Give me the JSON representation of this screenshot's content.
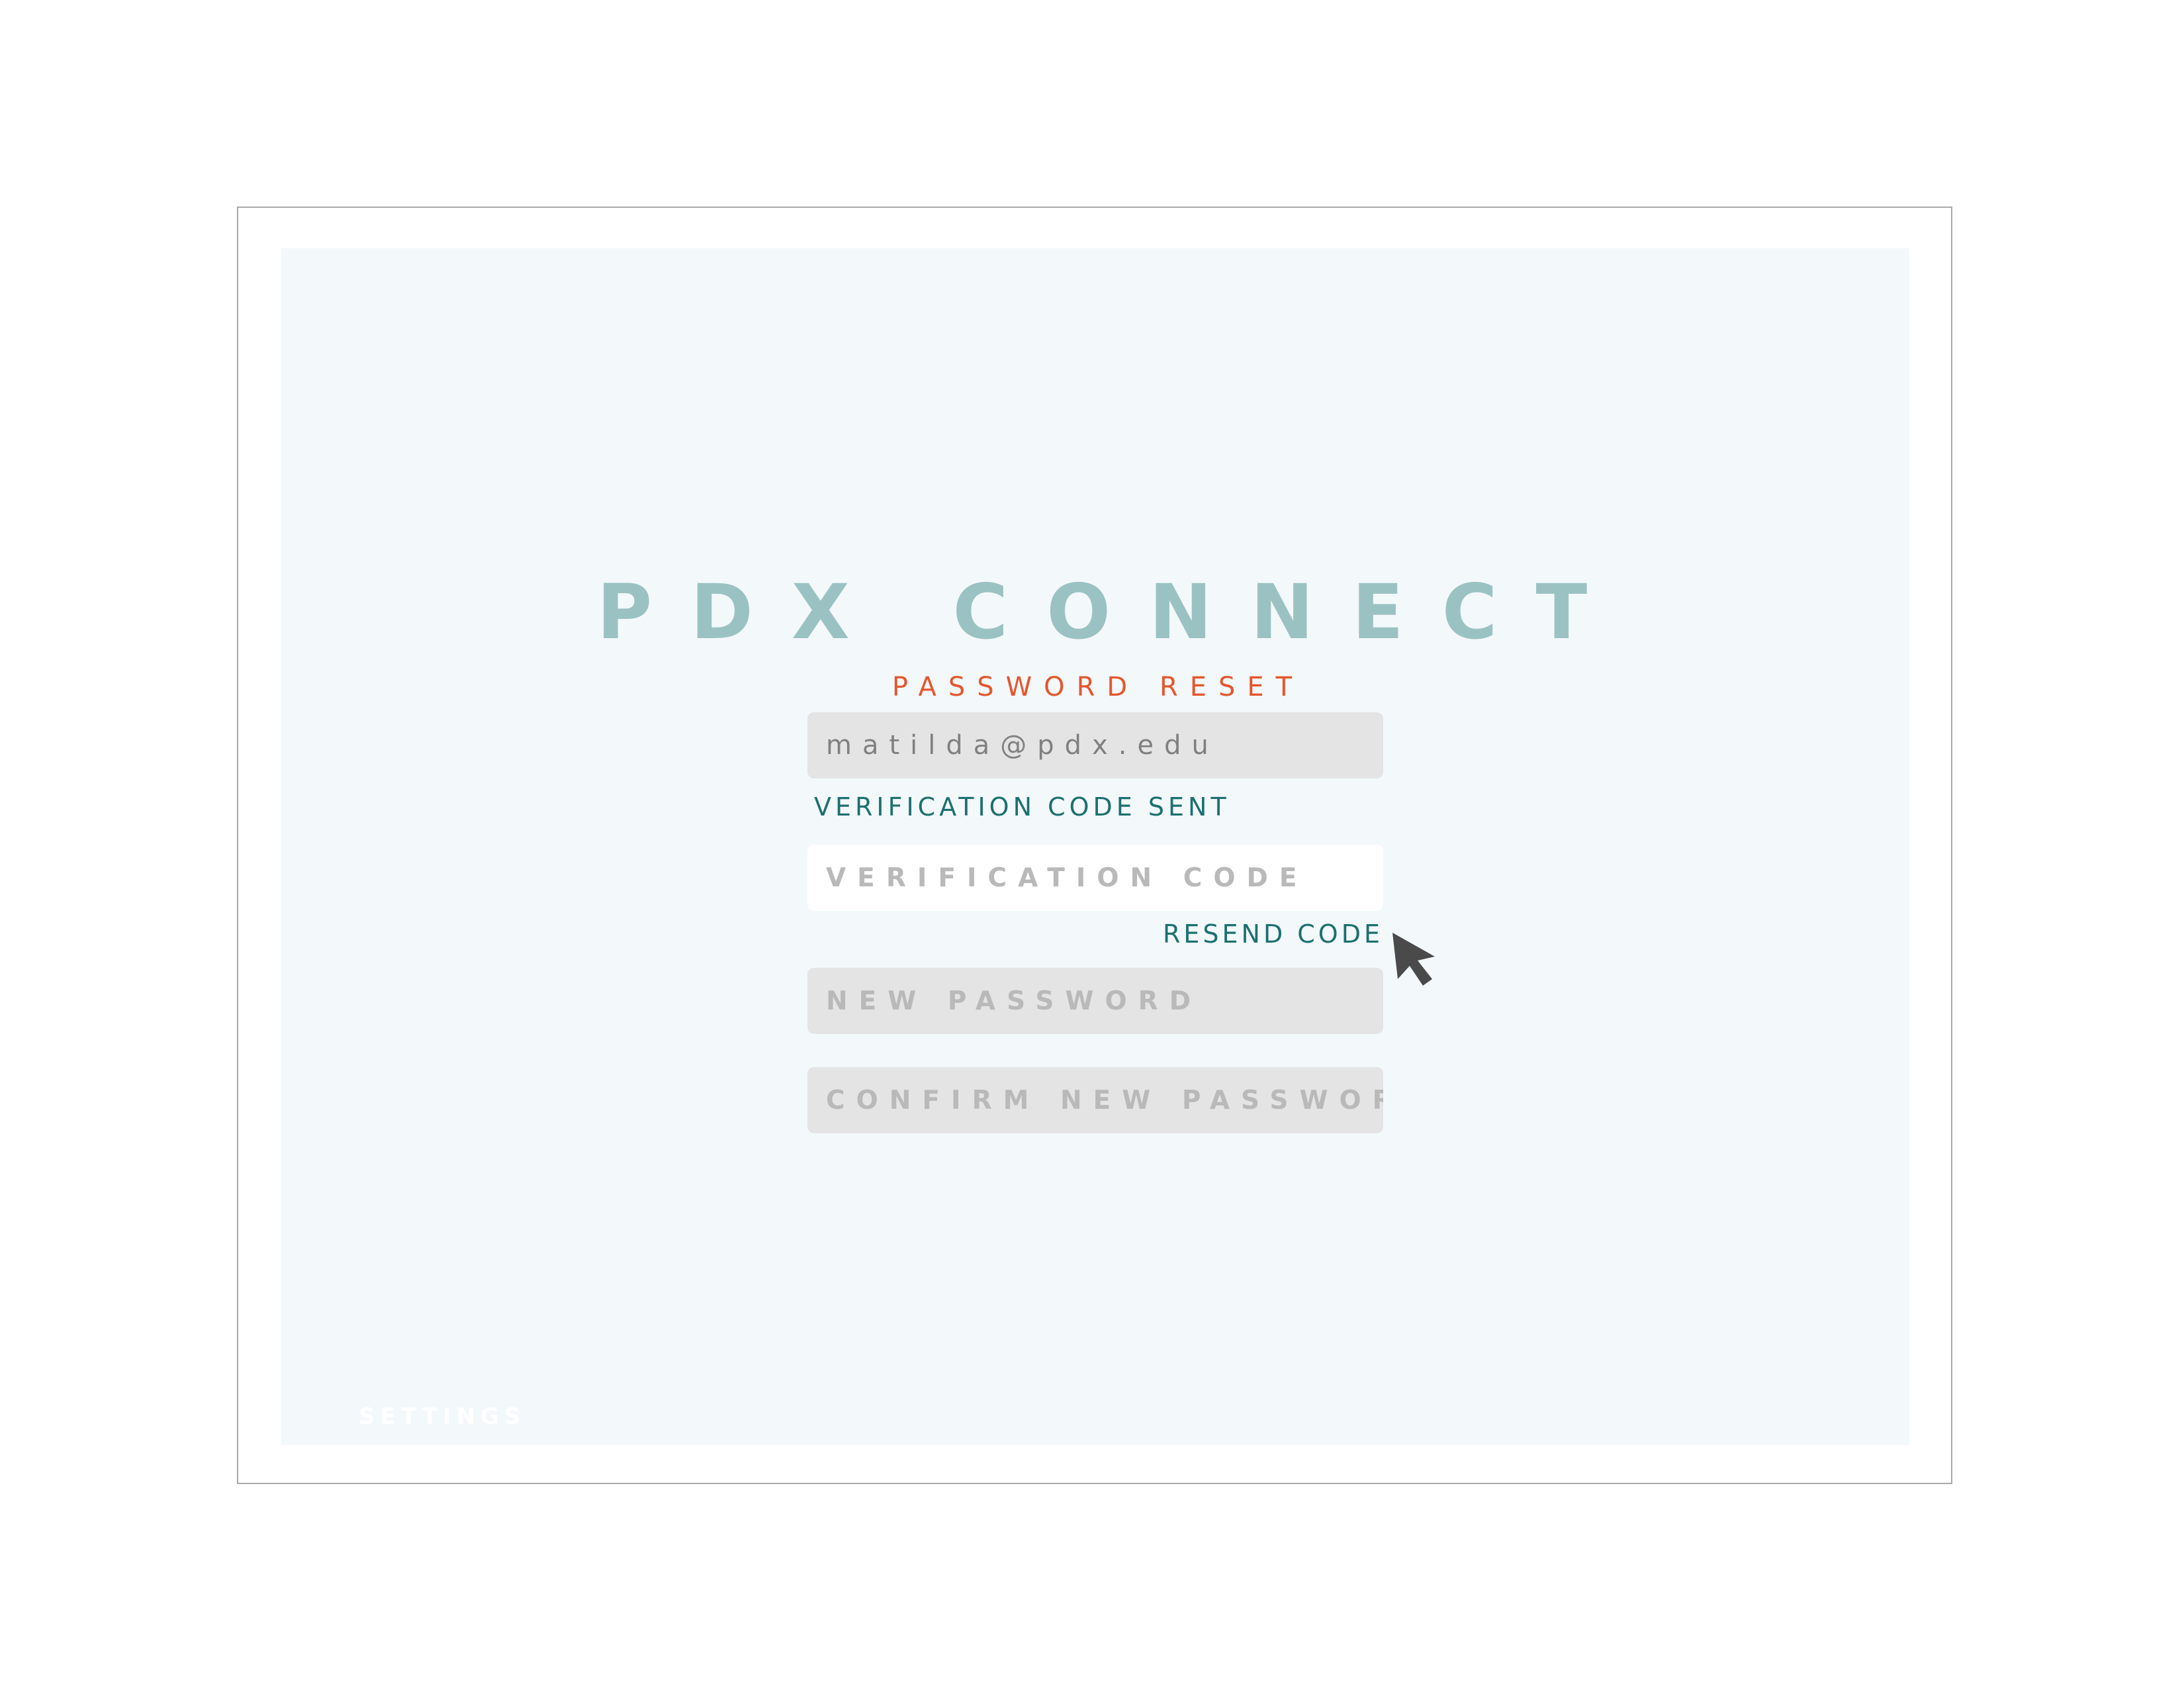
{
  "app": {
    "title": "PDX CONNECT",
    "subtitle": "PASSWORD RESET"
  },
  "form": {
    "email": {
      "value": "matilda@pdx.edu"
    },
    "status_message": "VERIFICATION CODE SENT",
    "verification_code": {
      "placeholder": "VERIFICATION CODE"
    },
    "resend_label": "RESEND CODE",
    "new_password": {
      "placeholder": "NEW PASSWORD"
    },
    "confirm_password": {
      "placeholder": "CONFIRM NEW PASSWORD"
    }
  },
  "footer": {
    "settings_label": "SETTINGS"
  },
  "icons": {
    "cursor": "cursor-arrow-icon"
  },
  "colors": {
    "title": "#9bc2c2",
    "subtitle": "#e4572e",
    "link": "#1c7070",
    "screen_background": "#f3f8fb",
    "field_background": "#e4e4e4"
  }
}
